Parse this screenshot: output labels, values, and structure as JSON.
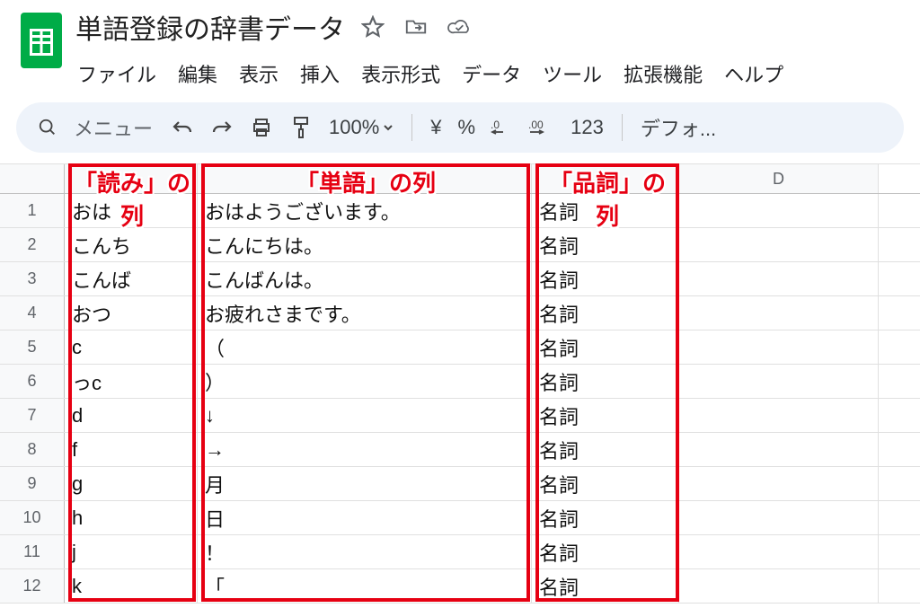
{
  "doc": {
    "title": "単語登録の辞書データ"
  },
  "menubar": {
    "file": "ファイル",
    "edit": "編集",
    "view": "表示",
    "insert": "挿入",
    "format": "表示形式",
    "data": "データ",
    "tools": "ツール",
    "extensions": "拡張機能",
    "help": "ヘルプ"
  },
  "toolbar": {
    "menu_hint": "メニュー",
    "zoom": "100%",
    "currency": "¥",
    "percent": "%",
    "dec_dec": ".0",
    "dec_inc": ".00",
    "numfmt": "123",
    "font": "デフォ..."
  },
  "columns": {
    "D": "D"
  },
  "annotations": {
    "colA": "「読み」の列",
    "colB": "「単語」の列",
    "colC": "「品詞」の列"
  },
  "rows": [
    {
      "n": "1",
      "a": "おは",
      "b": "おはようございます。",
      "c": "名詞"
    },
    {
      "n": "2",
      "a": "こんち",
      "b": "こんにちは。",
      "c": "名詞"
    },
    {
      "n": "3",
      "a": "こんば",
      "b": "こんばんは。",
      "c": "名詞"
    },
    {
      "n": "4",
      "a": "おつ",
      "b": "お疲れさまです。",
      "c": "名詞"
    },
    {
      "n": "5",
      "a": "c",
      "b": "（",
      "c": "名詞"
    },
    {
      "n": "6",
      "a": "っc",
      "b": "）",
      "c": "名詞"
    },
    {
      "n": "7",
      "a": "d",
      "b": "↓",
      "c": "名詞"
    },
    {
      "n": "8",
      "a": "f",
      "b": "→",
      "c": "名詞"
    },
    {
      "n": "9",
      "a": "g",
      "b": "月",
      "c": "名詞"
    },
    {
      "n": "10",
      "a": "h",
      "b": "日",
      "c": "名詞"
    },
    {
      "n": "11",
      "a": "j",
      "b": "！",
      "c": "名詞"
    },
    {
      "n": "12",
      "a": "k",
      "b": "「",
      "c": "名詞"
    }
  ]
}
